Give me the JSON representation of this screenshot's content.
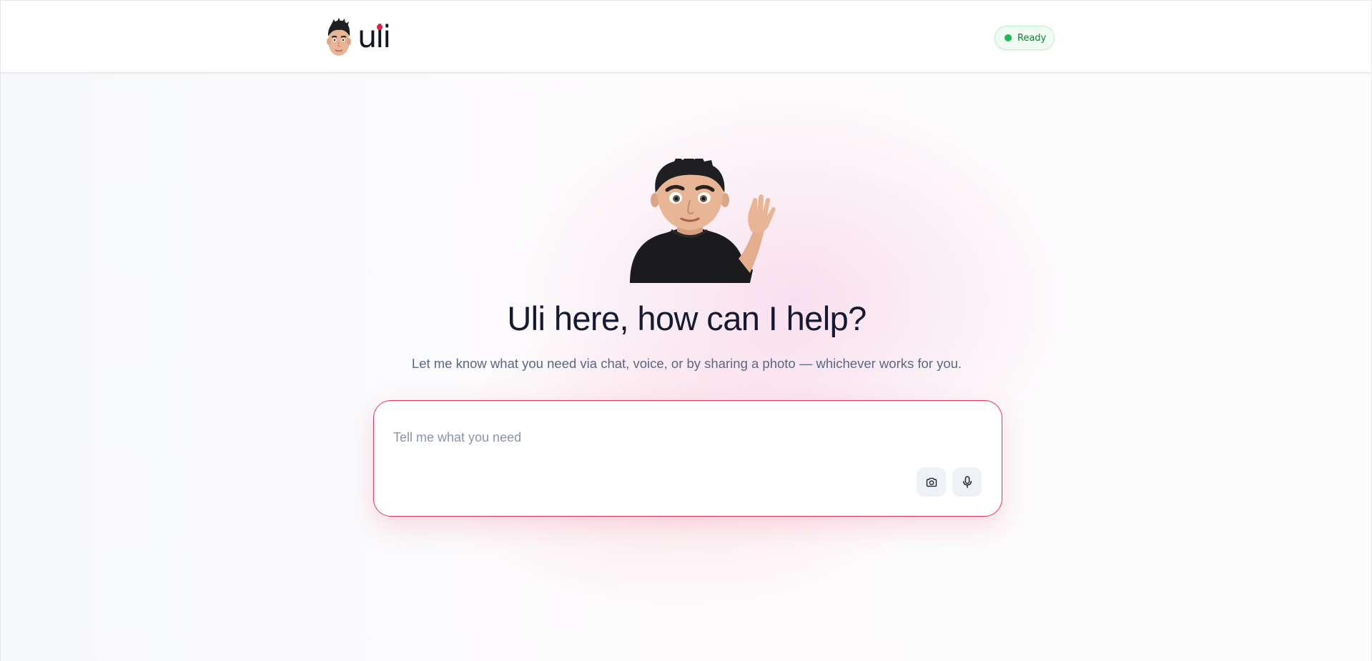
{
  "header": {
    "logo": {
      "text": "uli",
      "avatar_icon": "avatar-face-icon",
      "accent_color": "#e0213f"
    },
    "status": {
      "label": "Ready",
      "dot_color": "#1db954"
    }
  },
  "hero": {
    "illustration": "waving-man-illustration",
    "headline": "Uli here, how can I help?",
    "subline": "Let me know what you need via chat, voice, or by sharing a photo — whichever works for you."
  },
  "composer": {
    "placeholder": "Tell me what you need",
    "value": "",
    "border_color": "#e6355a",
    "buttons": [
      {
        "icon": "camera-icon",
        "label": "Share a photo"
      },
      {
        "icon": "microphone-icon",
        "label": "Voice"
      }
    ]
  }
}
